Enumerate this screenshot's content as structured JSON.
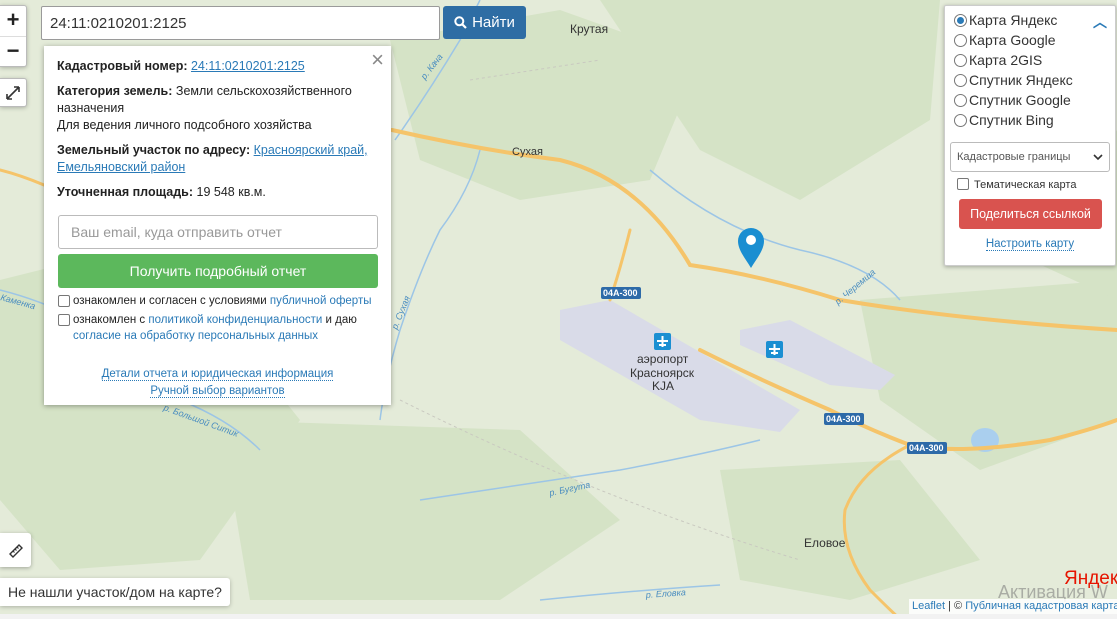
{
  "search": {
    "value": "24:11:0210201:2125",
    "button_label": "Найти"
  },
  "popup": {
    "close": "×",
    "cad_label": "Кадастровый номер:",
    "cad_value": "24:11:0210201:2125",
    "cat_label": "Категория земель:",
    "cat_value": "Земли сельскохозяйственного назначения",
    "use_value": "Для ведения личного подсобного хозяйства",
    "addr_label": "Земельный участок по адресу:",
    "addr_value": "Красноярский край, Емельяновский район",
    "area_label": "Уточненная площадь:",
    "area_value": "19 548 кв.м.",
    "email_placeholder": "Ваш email, куда отправить отчет",
    "report_button": "Получить подробный отчет",
    "agree1_prefix": "ознакомлен и согласен с условиями",
    "agree1_link": "публичной оферты",
    "agree2_prefix": "ознакомлен с",
    "agree2_link": "политикой конфиденциальности",
    "agree2_mid": "и даю",
    "agree2_link2": "согласие на обработку персональных данных",
    "details_link": "Детали отчета и юридическая информация",
    "manual_link": "Ручной выбор вариантов"
  },
  "layers": {
    "options": [
      "Карта Яндекс",
      "Карта Google",
      "Карта 2GIS",
      "Спутник Яндекс",
      "Спутник Google",
      "Спутник Bing"
    ],
    "selected": "Карта Яндекс",
    "select_value": "Кадастровые границы",
    "thematic": "Тематическая карта",
    "share_button": "Подели​ться ссылкой",
    "tune_link": "Настроить карту"
  },
  "map_labels": {
    "krutaya": "Крутая",
    "sukhaya": "Сухая",
    "road1": "04А-300",
    "road2": "04А-300",
    "road3": "04А-300",
    "airport_1": "аэропорт",
    "airport_2": "Красноярск",
    "airport_3": "KJA",
    "elovoe": "Еловое",
    "river_kacha": "р. Кача",
    "river_sukhaya": "р. Сухая",
    "river_cheremsha": "р. Черемша",
    "river_bolshoy_sitik": "р. Большой Ситик",
    "river_buguta": "р. Бугута",
    "river_elovka": "р. Еловка",
    "river_kamenka": "Каменка"
  },
  "not_found": "Не нашли участок/дом на карте?",
  "yandex_logo": "Яндекс",
  "attribution": {
    "leaflet": "Leaflet",
    "separator": "| ©",
    "pkk": "Публичная кадастровая карта"
  },
  "watermark": "Активация W",
  "colors": {
    "accent": "#2e6da4",
    "report_green": "#5cb85c",
    "share_red": "#d9534f",
    "marker": "#1a8ed1",
    "roads": "#f5c46a"
  }
}
